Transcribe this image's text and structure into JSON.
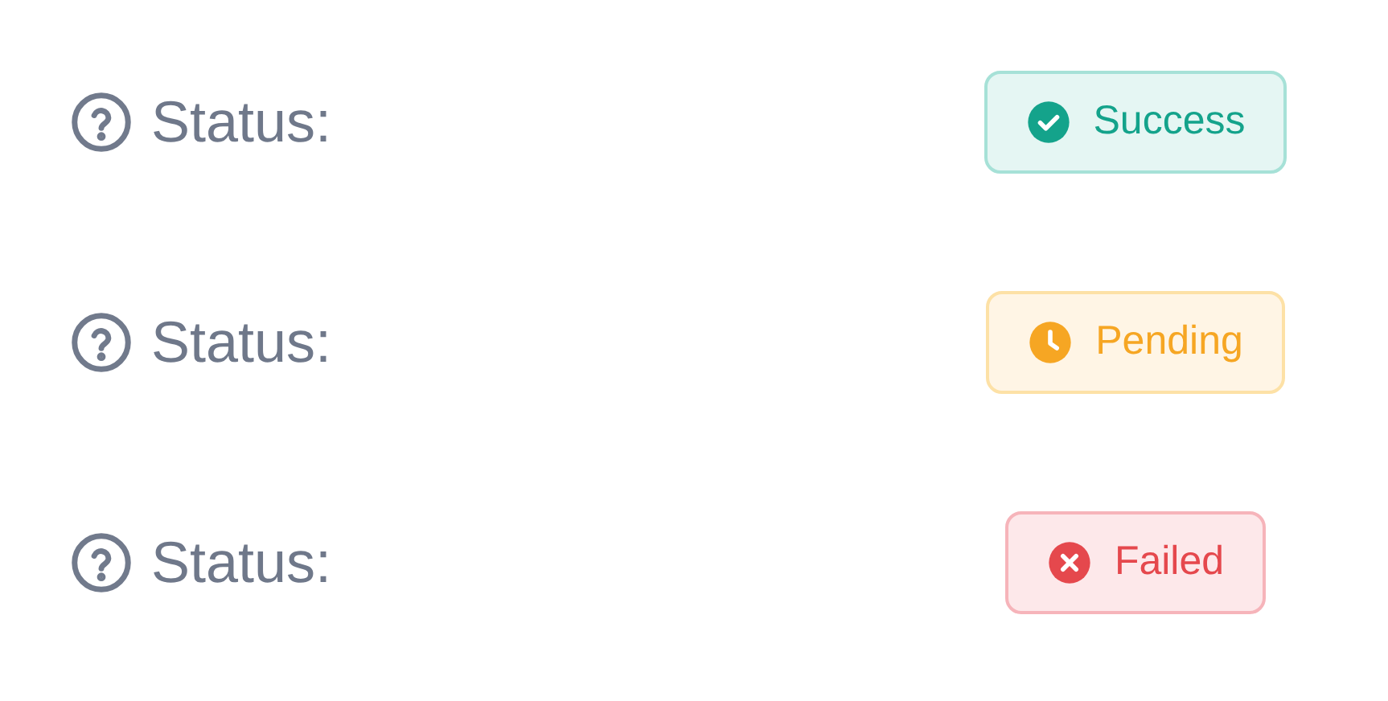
{
  "rows": [
    {
      "label": "Status:",
      "badge": {
        "kind": "success",
        "text": "Success",
        "color": "#14a38b"
      }
    },
    {
      "label": "Status:",
      "badge": {
        "kind": "pending",
        "text": "Pending",
        "color": "#f6a623"
      }
    },
    {
      "label": "Status:",
      "badge": {
        "kind": "failed",
        "text": "Failed",
        "color": "#e5484d"
      }
    }
  ]
}
